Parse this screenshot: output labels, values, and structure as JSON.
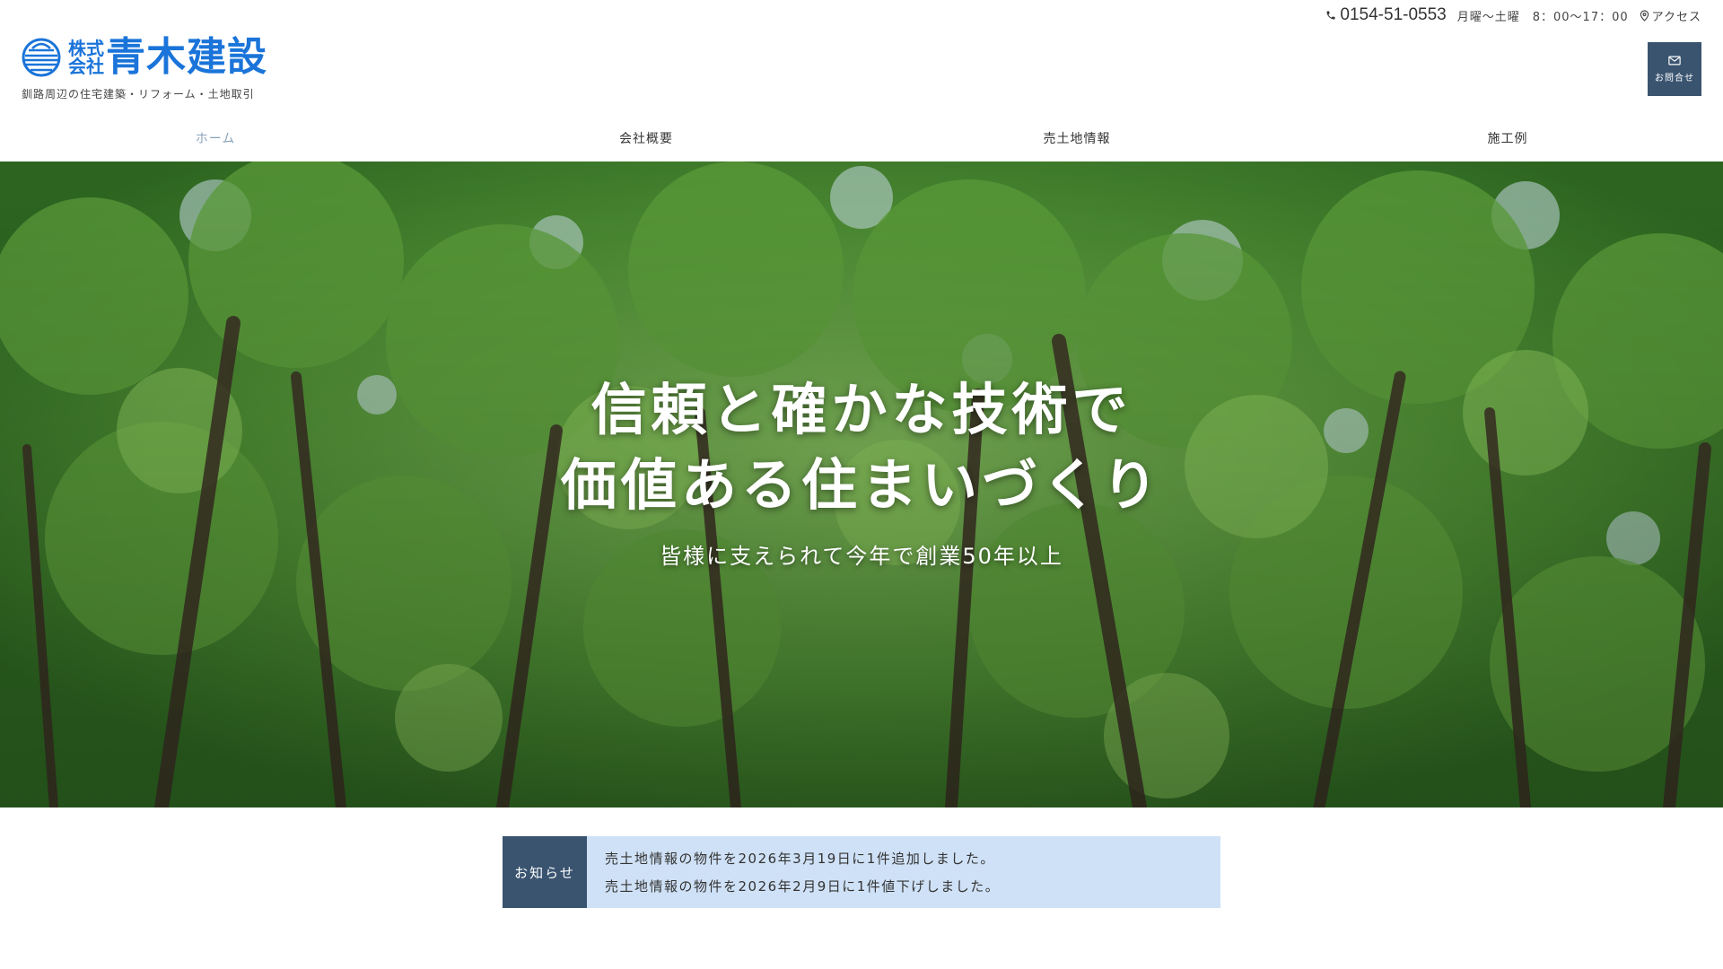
{
  "header": {
    "phone": "0154-51-0553",
    "hours": "月曜～土曜　8：00～17：00",
    "access_label": "アクセス",
    "logo_kabu_line1": "株式",
    "logo_kabu_line2": "会社",
    "logo_name": "青木建設",
    "tagline": "釧路周辺の住宅建築・リフォーム・土地取引",
    "contact_label": "お問合せ"
  },
  "nav": {
    "items": [
      {
        "label": "ホーム",
        "active": true
      },
      {
        "label": "会社概要",
        "active": false
      },
      {
        "label": "売土地情報",
        "active": false
      },
      {
        "label": "施工例",
        "active": false
      }
    ]
  },
  "hero": {
    "title_line1": "信頼と確かな技術で",
    "title_line2": "価値ある住まいづくり",
    "subtitle": "皆様に支えられて今年で創業50年以上"
  },
  "news": {
    "label": "お知らせ",
    "items": [
      "売土地情報の物件を2026年3月19日に1件追加しました。",
      "売土地情報の物件を2026年2月9日に1件値下げしました。"
    ]
  },
  "colors": {
    "brand_blue": "#1a74d9",
    "navy": "#3a5470",
    "news_bg": "#cfe1f6",
    "nav_active": "#8aa3bb"
  }
}
